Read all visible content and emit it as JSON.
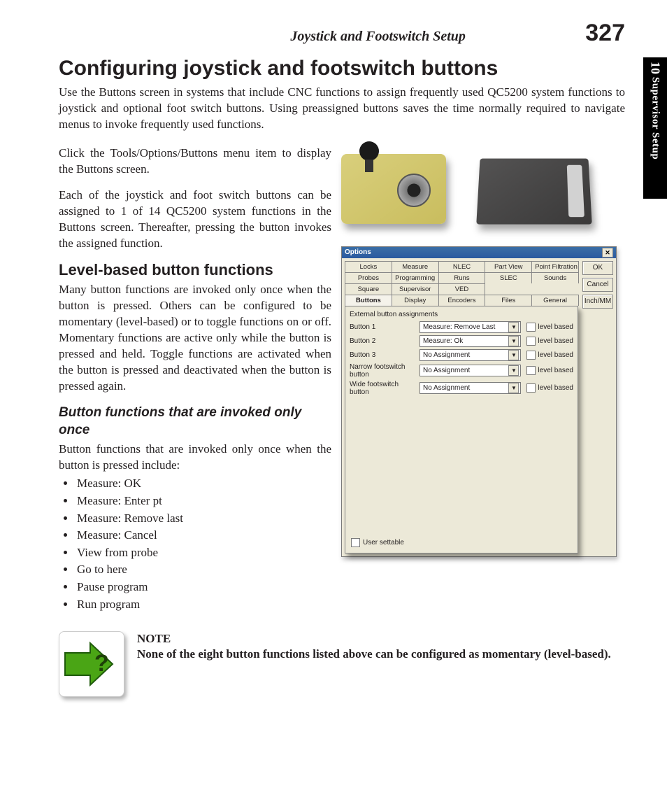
{
  "header": {
    "running_title": "Joystick and Footswitch Setup",
    "page_number": "327"
  },
  "side_tab": {
    "chapter_number": "10",
    "chapter_title": "Supervisor Setup"
  },
  "headings": {
    "h1": "Configuring joystick and footswitch buttons",
    "h2": "Level-based button functions",
    "h3": "Button functions that are invoked only once"
  },
  "paragraphs": {
    "intro": "Use the Buttons screen in systems that include CNC functions to assign frequently used QC5200 system functions to joystick and optional foot switch buttons. Using preassigned buttons saves the time normally required to navigate menus to invoke frequently used functions.",
    "click_path": "Click the Tools/Options/Buttons menu item to display the Buttons screen.",
    "assign": "Each of the joystick and foot switch buttons can be assigned to 1 of 14 QC5200 system functions in the Buttons screen. Thereafter, pressing the button invokes the assigned function.",
    "level_based": "Many button functions are invoked only once when the button is pressed. Others can be configured to be momentary (level-based) or to toggle functions on or off. Momentary functions are active only while the button is pressed and held. Toggle functions are activated when the button is pressed and deactivated when the button is pressed again.",
    "invoked_once": "Button functions that are invoked only once when the button is pressed include:"
  },
  "bullet_list": [
    "Measure: OK",
    "Measure: Enter pt",
    "Measure: Remove last",
    "Measure: Cancel",
    "View from probe",
    "Go to here",
    "Pause program",
    "Run program"
  ],
  "note": {
    "head": "NOTE",
    "body": "None of the eight button functions listed above can be configured as momentary (level-based)."
  },
  "dialog": {
    "title": "Options",
    "close_glyph": "✕",
    "buttons": {
      "ok": "OK",
      "cancel": "Cancel",
      "inchmm": "Inch/MM"
    },
    "tab_rows": [
      [
        "Locks",
        "Measure",
        "NLEC",
        "Part View",
        "Point Filtration"
      ],
      [
        "Probes",
        "Programming",
        "Runs",
        "SLEC",
        "Sounds"
      ],
      [
        "Square",
        "Supervisor",
        "VED",
        "",
        ""
      ],
      [
        "Buttons",
        "Display",
        "Encoders",
        "Files",
        "General"
      ]
    ],
    "active_tab": "Buttons",
    "section_label": "External button assignments",
    "assignments": [
      {
        "label": "Button 1",
        "value": "Measure: Remove Last",
        "level_label": "level based"
      },
      {
        "label": "Button 2",
        "value": "Measure: Ok",
        "level_label": "level based"
      },
      {
        "label": "Button 3",
        "value": "No Assignment",
        "level_label": "level based"
      },
      {
        "label": "Narrow footswitch button",
        "value": "No Assignment",
        "level_label": "level based"
      },
      {
        "label": "Wide footswitch button",
        "value": "No Assignment",
        "level_label": "level based"
      }
    ],
    "user_settable": "User settable",
    "caret": "▼"
  }
}
